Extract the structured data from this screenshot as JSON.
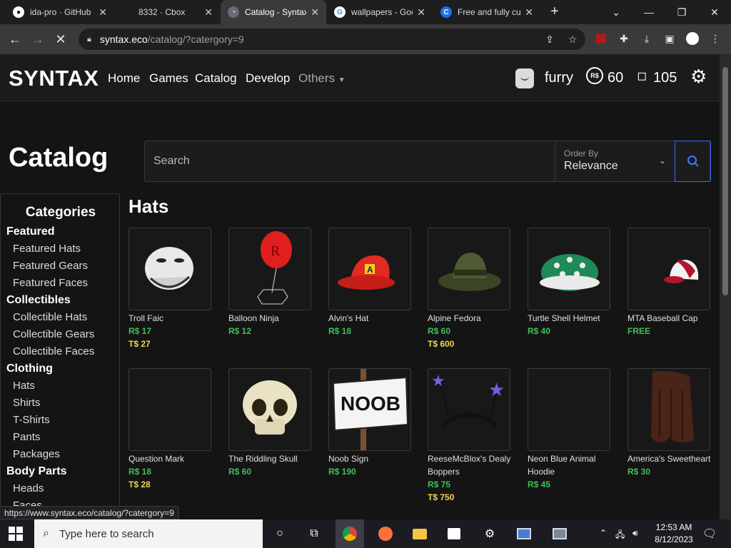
{
  "browser": {
    "tabs": [
      {
        "title": "ida-pro · GitHub",
        "icon": "github-icon"
      },
      {
        "title": "8332 · Cbox",
        "icon": "blank-page-icon"
      },
      {
        "title": "Catalog - Syntax",
        "icon": "syntax-icon",
        "active": true
      },
      {
        "title": "wallpapers - Google",
        "icon": "google-icon"
      },
      {
        "title": "Free and fully cu",
        "icon": "c-icon"
      }
    ],
    "url_host": "syntax.eco",
    "url_path": "/catalog/?catergory=9",
    "status_url": "https://www.syntax.eco/catalog/?catergory=9"
  },
  "site": {
    "logo": "SYNTAX",
    "nav": [
      "Home",
      "Games",
      "Catalog",
      "Develop"
    ],
    "others": "Others",
    "username": "furry",
    "robux_symbol": "R$",
    "robux": "60",
    "tix": "105"
  },
  "catalog": {
    "title": "Catalog",
    "search_placeholder": "Search",
    "order_label": "Order By",
    "order_value": "Relevance",
    "sidebar_title": "Categories",
    "section_title": "Hats"
  },
  "categories": [
    {
      "type": "head",
      "label": "Featured"
    },
    {
      "type": "item",
      "label": "Featured Hats"
    },
    {
      "type": "item",
      "label": "Featured Gears"
    },
    {
      "type": "item",
      "label": "Featured Faces"
    },
    {
      "type": "head",
      "label": "Collectibles"
    },
    {
      "type": "item",
      "label": "Collectible Hats"
    },
    {
      "type": "item",
      "label": "Collectible Gears"
    },
    {
      "type": "item",
      "label": "Collectible Faces"
    },
    {
      "type": "head",
      "label": "Clothing"
    },
    {
      "type": "item",
      "label": "Hats"
    },
    {
      "type": "item",
      "label": "Shirts"
    },
    {
      "type": "item",
      "label": "T-Shirts"
    },
    {
      "type": "item",
      "label": "Pants"
    },
    {
      "type": "item",
      "label": "Packages"
    },
    {
      "type": "head",
      "label": "Body Parts"
    },
    {
      "type": "item",
      "label": "Heads"
    },
    {
      "type": "item",
      "label": "Faces"
    }
  ],
  "items": [
    {
      "name": "Troll Faic",
      "robux": "R$ 17",
      "tix": "T$ 27",
      "art": "troll-face"
    },
    {
      "name": "Balloon Ninja",
      "robux": "R$ 12",
      "tix": "",
      "art": "balloon"
    },
    {
      "name": "Alvin's Hat",
      "robux": "R$ 18",
      "tix": "",
      "art": "red-cap"
    },
    {
      "name": "Alpine Fedora",
      "robux": "R$ 60",
      "tix": "T$ 600",
      "art": "fedora"
    },
    {
      "name": "Turtle Shell Helmet",
      "robux": "R$ 40",
      "tix": "",
      "art": "turtle-shell"
    },
    {
      "name": "MTA Baseball Cap",
      "robux": "FREE",
      "tix": "",
      "art": "baseball-cap"
    },
    {
      "name": "Question Mark",
      "robux": "R$ 18",
      "tix": "T$ 28",
      "art": "empty"
    },
    {
      "name": "The Riddling Skull",
      "robux": "R$ 60",
      "tix": "",
      "art": "skull"
    },
    {
      "name": "Noob Sign",
      "robux": "R$ 190",
      "tix": "",
      "art": "noob-sign",
      "sign_text": "NOOB"
    },
    {
      "name": "ReeseMcBlox's Dealy Boppers",
      "robux": "R$ 75",
      "tix": "T$ 750",
      "art": "boppers"
    },
    {
      "name": "Neon Blue Animal Hoodie",
      "robux": "R$ 45",
      "tix": "",
      "art": "empty"
    },
    {
      "name": "America's Sweetheart",
      "robux": "R$ 30",
      "tix": "",
      "art": "hair"
    }
  ],
  "taskbar": {
    "search_placeholder": "Type here to search",
    "time": "12:53 AM",
    "date": "8/12/2023"
  },
  "colors": {
    "robux_green": "#3fbf5a",
    "tix_yellow": "#f0d44a",
    "accent_blue": "#2f6fff"
  }
}
